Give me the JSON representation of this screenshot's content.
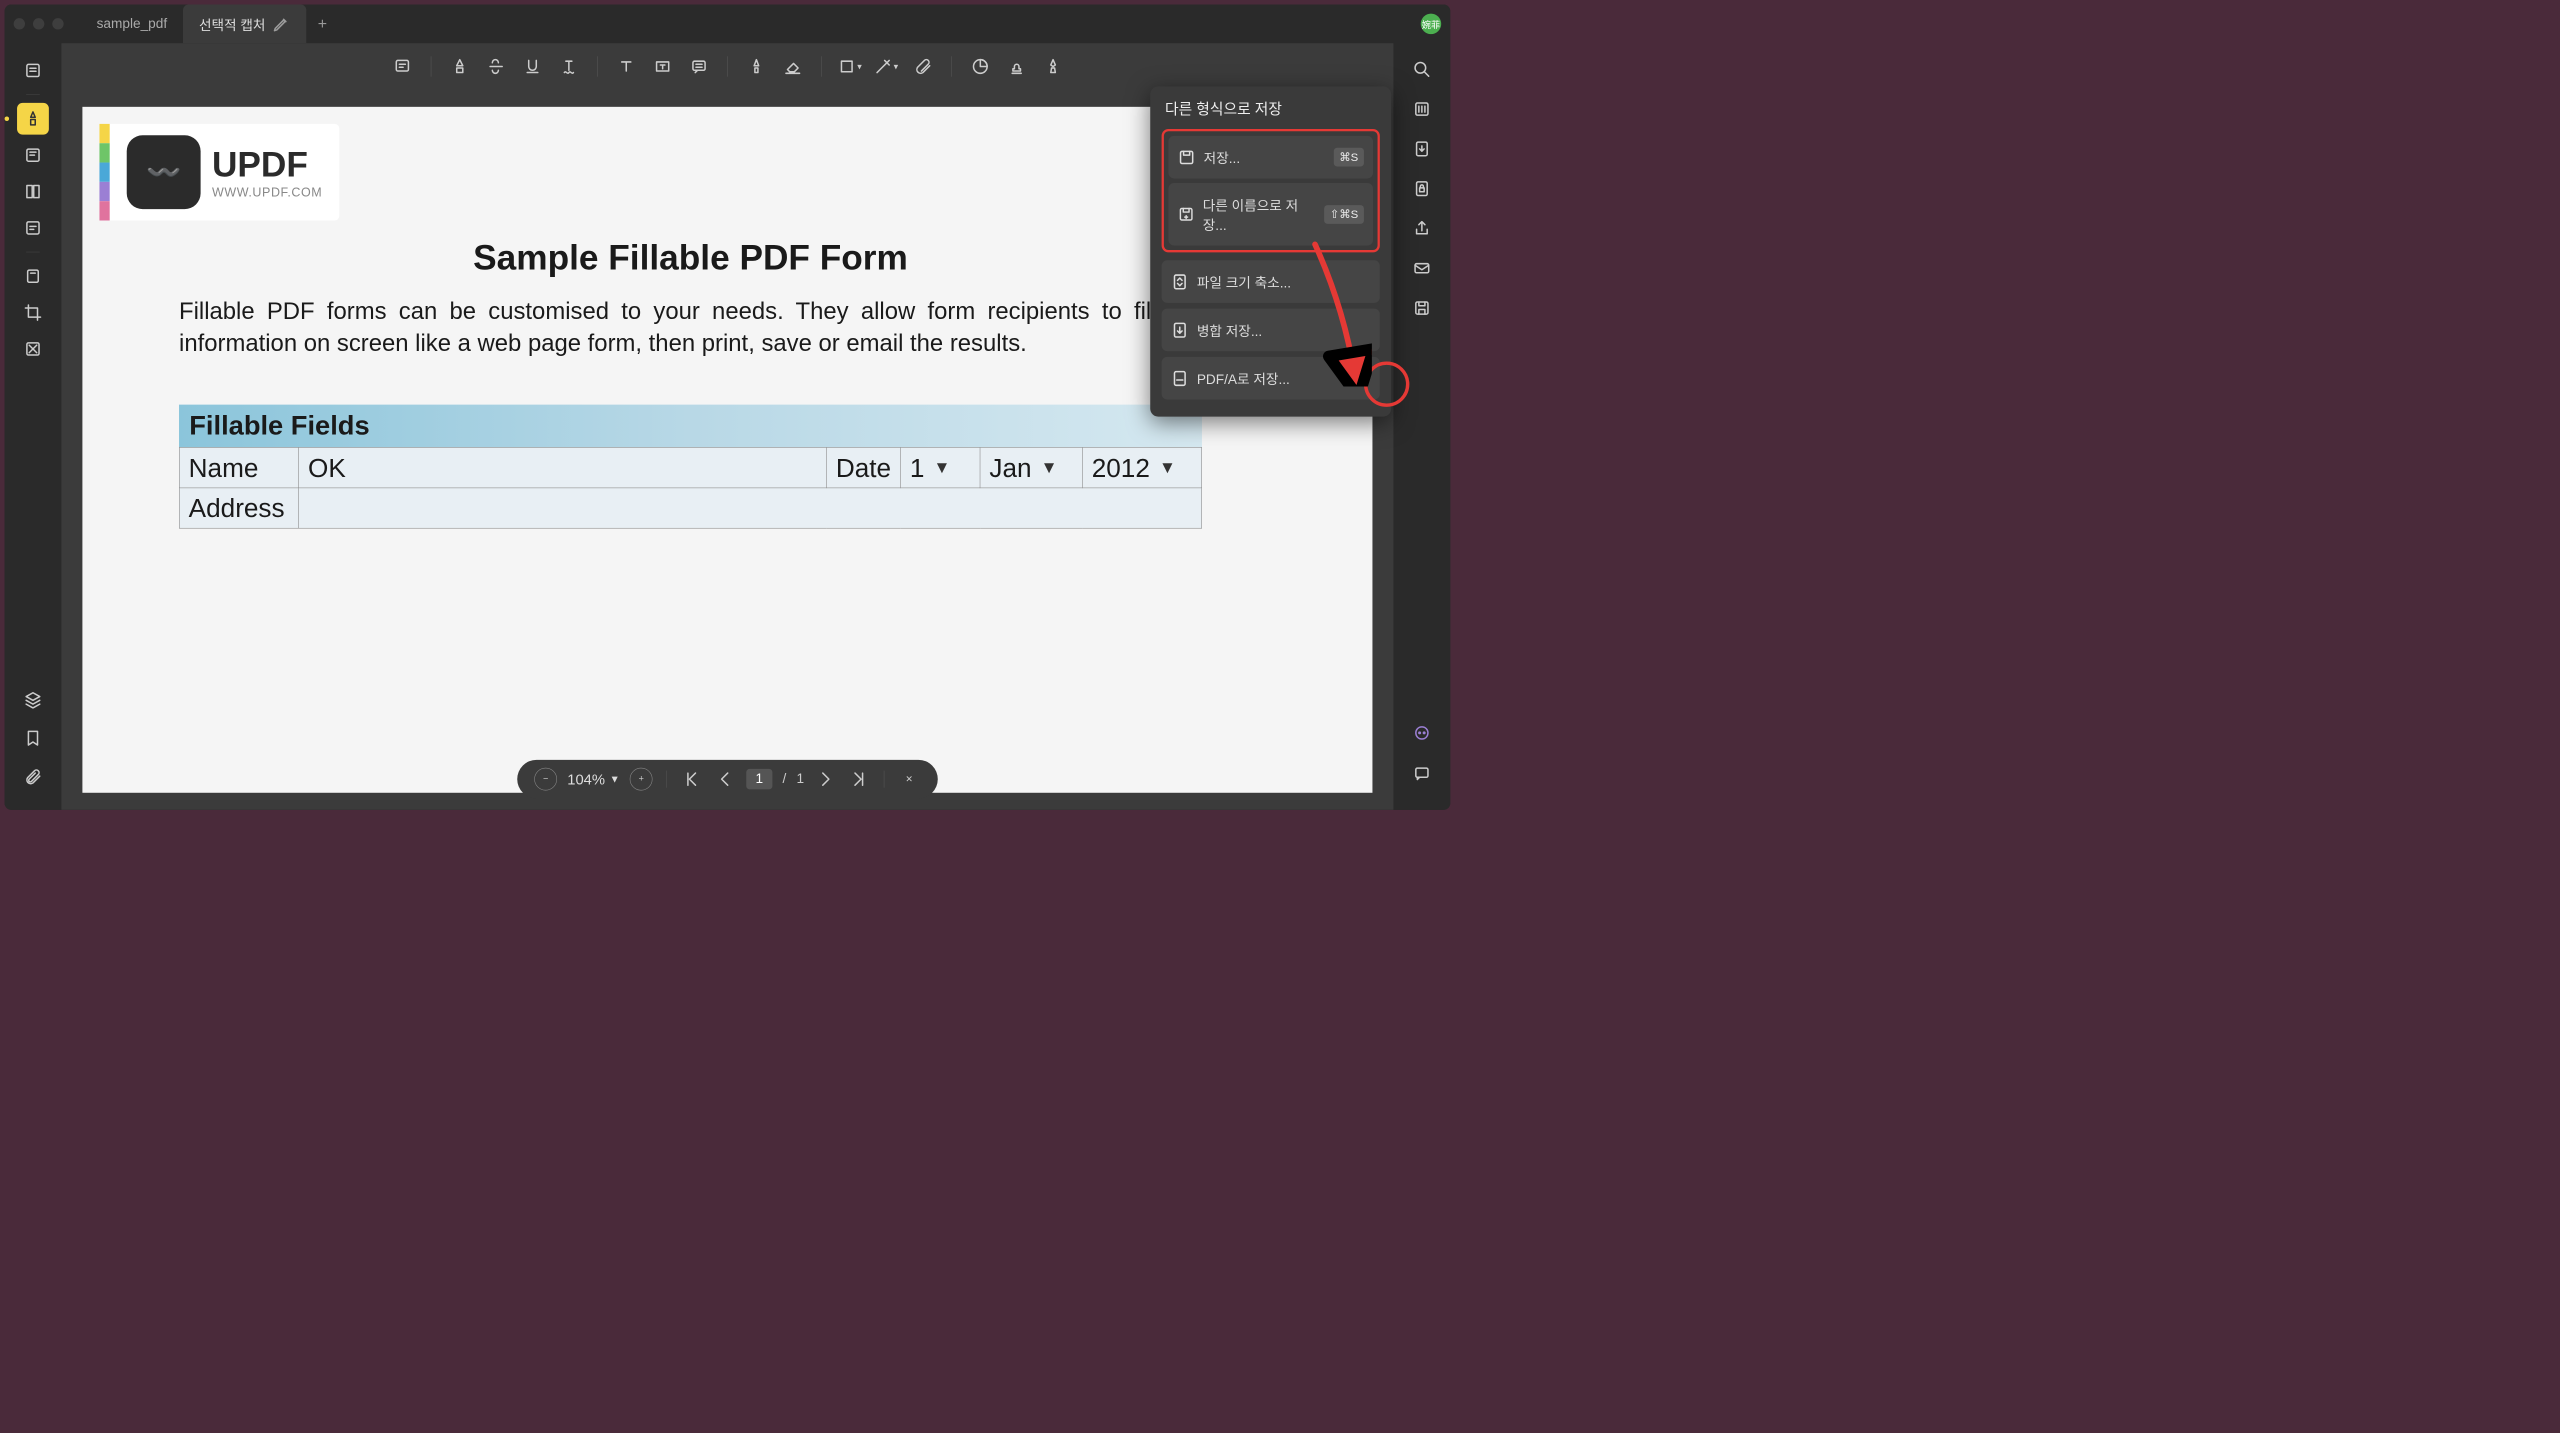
{
  "tabs": [
    {
      "label": "sample_pdf",
      "active": false
    },
    {
      "label": "선택적 캡처",
      "active": true
    }
  ],
  "avatar_text": "婉菲",
  "popover": {
    "title": "다른 형식으로 저장",
    "save": "저장...",
    "save_kbd": "⌘S",
    "save_as": "다른 이름으로 저장...",
    "save_as_kbd": "⇧⌘S",
    "reduce": "파일 크기 축소...",
    "merge": "병합 저장...",
    "pdfa": "PDF/A로 저장..."
  },
  "doc": {
    "brand": "UPDF",
    "site": "WWW.UPDF.COM",
    "title": "Sample Fillable PDF Form",
    "body": "Fillable PDF forms can be customised to your needs. They allow form recipients to fill out information on screen like a web page form, then print, save or email the results.",
    "section": "Fillable Fields",
    "name_label": "Name",
    "name_value": "OK",
    "date_label": "Date",
    "day": "1",
    "month": "Jan",
    "year": "2012",
    "address_label": "Address",
    "address_value": ""
  },
  "bottombar": {
    "zoom": "104%",
    "page_current": "1",
    "page_sep": "/",
    "page_total": "1"
  }
}
